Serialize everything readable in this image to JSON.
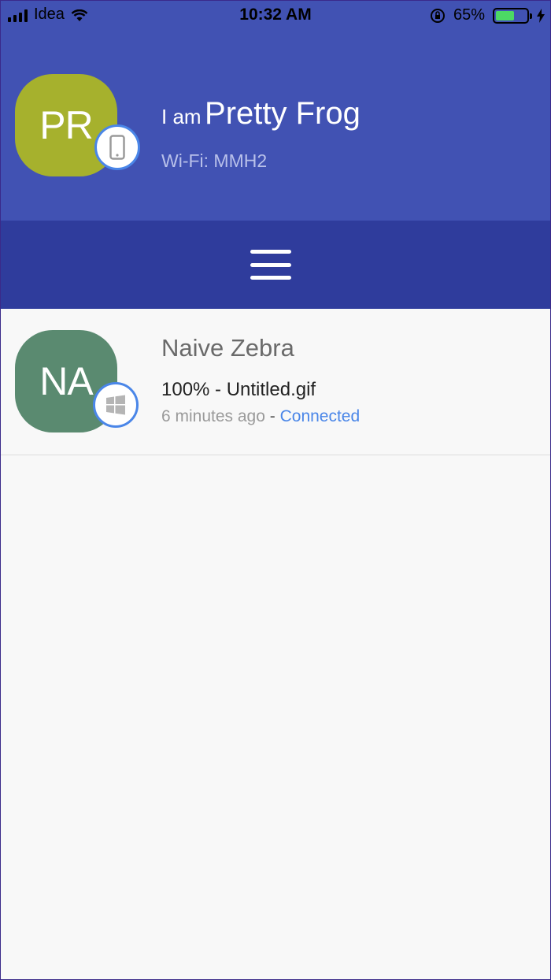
{
  "status_bar": {
    "carrier": "Idea",
    "time": "10:32 AM",
    "battery_percent": "65%",
    "battery_level": 0.65,
    "battery_color": "#4cd964"
  },
  "profile": {
    "initials": "PR",
    "greeting_prefix": "I am",
    "device_name": "Pretty Frog",
    "wifi": "Wi-Fi: MMH2",
    "avatar_color": "#a6b12d",
    "device_icon": "phone-icon"
  },
  "menu": {
    "icon": "hamburger-menu-icon"
  },
  "peers": [
    {
      "initials": "NA",
      "name": "Naive Zebra",
      "transfer": "100% - Untitled.gif",
      "time": "6 minutes ago",
      "separator": " - ",
      "status": "Connected",
      "avatar_color": "#5a8a70",
      "device_icon": "windows-icon"
    }
  ],
  "colors": {
    "header": "#4152b3",
    "menu_bar": "#2f3c9c",
    "accent": "#4a86e8",
    "background": "#f8f8f8"
  }
}
